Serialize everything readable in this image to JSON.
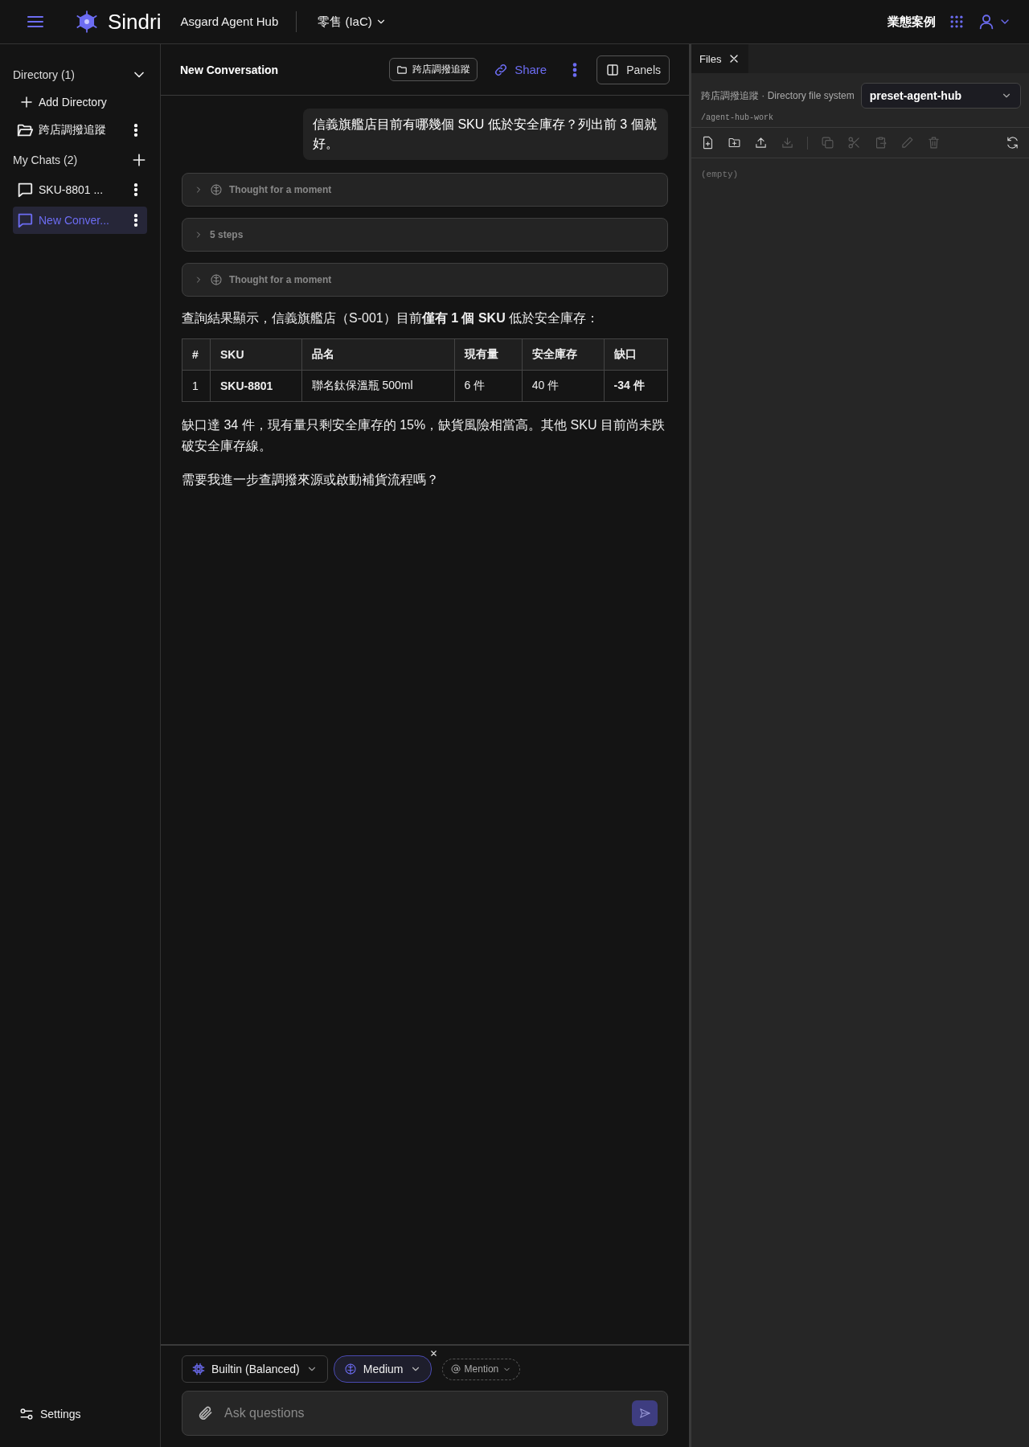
{
  "topbar": {
    "brand": "Sindri",
    "app_name": "Asgard Agent Hub",
    "workspace": "零售 (IaC)",
    "link": "業態案例"
  },
  "sidebar": {
    "directory_header": "Directory (1)",
    "directory_expanded": true,
    "add_directory": "Add Directory",
    "directories": [
      {
        "label": "跨店調撥追蹤"
      }
    ],
    "chats_header": "My Chats (2)",
    "chats": [
      {
        "label": "SKU-8801 ...",
        "selected": false
      },
      {
        "label": "New Conver...",
        "selected": true
      }
    ],
    "settings": "Settings"
  },
  "chat": {
    "title": "New Conversation",
    "directory_chip": "跨店調撥追蹤",
    "share": "Share",
    "panels": "Panels",
    "messages": [
      {
        "kind": "user",
        "text": "信義旗艦店目前有哪幾個 SKU 低於安全庫存？列出前 3 個就好。"
      },
      {
        "kind": "thought",
        "label": "Thought for a moment",
        "expanded": false
      },
      {
        "kind": "steps",
        "label": "5 steps",
        "expanded": false
      },
      {
        "kind": "thought",
        "label": "Thought for a moment",
        "expanded": false
      },
      {
        "kind": "text",
        "text": "查詢結果顯示，信義旗艦店（S-001）目前**僅有 1 個 SKU** 低於安全庫存："
      },
      {
        "kind": "table",
        "columns": [
          "#",
          "SKU",
          "品名",
          "現有量",
          "安全庫存",
          "缺口"
        ],
        "rows": [
          [
            {
              "text": "1",
              "bold": false
            },
            {
              "text": "SKU-8801",
              "bold": true
            },
            {
              "text": "聯名鈦保溫瓶 500ml",
              "bold": false
            },
            {
              "text": "6 件",
              "bold": false
            },
            {
              "text": "40 件",
              "bold": false
            },
            {
              "text": "-34 件",
              "bold": true
            }
          ]
        ]
      },
      {
        "kind": "text",
        "text": "缺口達 34 件，現有量只剩安全庫存的 15%，缺貨風險相當高。其他 SKU 目前尚未跌破安全庫存線。"
      },
      {
        "kind": "text",
        "text": "需要我進一步查調撥來源或啟動補貨流程嗎？"
      }
    ],
    "composer": {
      "model": "Builtin (Balanced)",
      "effort": "Medium",
      "mention": "Mention",
      "placeholder": "Ask questions"
    }
  },
  "files": {
    "tab": "Files",
    "source": "跨店調撥追蹤 · Directory file system",
    "filesystem": "preset-agent-hub",
    "path": "/agent-hub-work",
    "toolbar": [
      {
        "kind": "new-file",
        "disabled": false
      },
      {
        "kind": "new-folder",
        "disabled": false
      },
      {
        "kind": "upload",
        "disabled": false
      },
      {
        "kind": "download",
        "disabled": true
      },
      {
        "kind": "separator"
      },
      {
        "kind": "copy",
        "disabled": true
      },
      {
        "kind": "cut",
        "disabled": true
      },
      {
        "kind": "paste",
        "disabled": true
      },
      {
        "kind": "rename",
        "disabled": true
      },
      {
        "kind": "delete",
        "disabled": true
      },
      {
        "kind": "spacer"
      },
      {
        "kind": "refresh",
        "disabled": false
      }
    ],
    "empty_text": "(empty)"
  }
}
